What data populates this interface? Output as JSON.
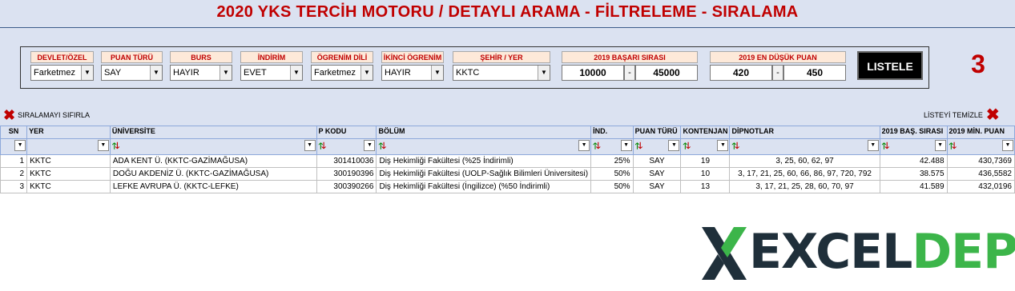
{
  "title": "2020  YKS  TERCİH MOTORU / DETAYLI ARAMA - FİLTRELEME - SIRALAMA",
  "filters": [
    {
      "label": "DEVLET/ÖZEL",
      "value": "Farketmez"
    },
    {
      "label": "PUAN TÜRÜ",
      "value": "SAY"
    },
    {
      "label": "BURS",
      "value": "HAYIR"
    },
    {
      "label": "İNDİRİM",
      "value": "EVET"
    },
    {
      "label": "ÖGRENİM DİLİ",
      "value": "Farketmez"
    },
    {
      "label": "İKİNCİ ÖGRENİM",
      "value": "HAYIR"
    },
    {
      "label": "ŞEHİR / YER",
      "value": "KKTC"
    }
  ],
  "rank_filter": {
    "label": "2019 BAŞARI SIRASI",
    "min": "10000",
    "sep": "-",
    "max": "45000"
  },
  "score_filter": {
    "label": "2019 EN DÜŞÜK PUAN",
    "min": "420",
    "sep": "-",
    "max": "450"
  },
  "list_button": "LISTELE",
  "result_count": "3",
  "reset_sort": "SIRALAMAYI SIFIRLA",
  "clear_list": "LİSTEYİ TEMİZLE",
  "columns": [
    "SN",
    "YER",
    "ÜNİVERSİTE",
    "P KODU",
    "BÖLÜM",
    "İND.",
    "PUAN TÜRÜ",
    "KONTENJAN",
    "DİPNOTLAR",
    "2019 BAŞ. SIRASI",
    "2019 MİN. PUAN"
  ],
  "rows": [
    [
      "1",
      "KKTC",
      "ADA KENT Ü. (KKTC-GAZİMAĞUSA)",
      "301410036",
      "Diş Hekimliği Fakültesi (%25 İndirimli)",
      "25%",
      "SAY",
      "19",
      "3, 25, 60, 62, 97",
      "42.488",
      "430,7369"
    ],
    [
      "2",
      "KKTC",
      "DOĞU AKDENİZ Ü. (KKTC-GAZİMAĞUSA)",
      "300190396",
      "Diş Hekimliği Fakültesi (UOLP-Sağlık Bilimleri Üniversitesi)",
      "50%",
      "SAY",
      "10",
      "3, 17, 21, 25, 60, 66, 86, 97, 720, 792",
      "38.575",
      "436,5582"
    ],
    [
      "3",
      "KKTC",
      "LEFKE AVRUPA Ü. (KKTC-LEFKE)",
      "300390266",
      "Diş Hekimliği Fakültesi (İngilizce) (%50 İndirimli)",
      "50%",
      "SAY",
      "13",
      "3, 17, 21, 25, 28, 60, 70, 97",
      "41.589",
      "432,0196"
    ]
  ],
  "logo": {
    "part1": "EXCEL",
    "part2": "DEPO",
    "mark": "X",
    "color_dark": "#1f2f3a",
    "color_green": "#3cb54a"
  }
}
